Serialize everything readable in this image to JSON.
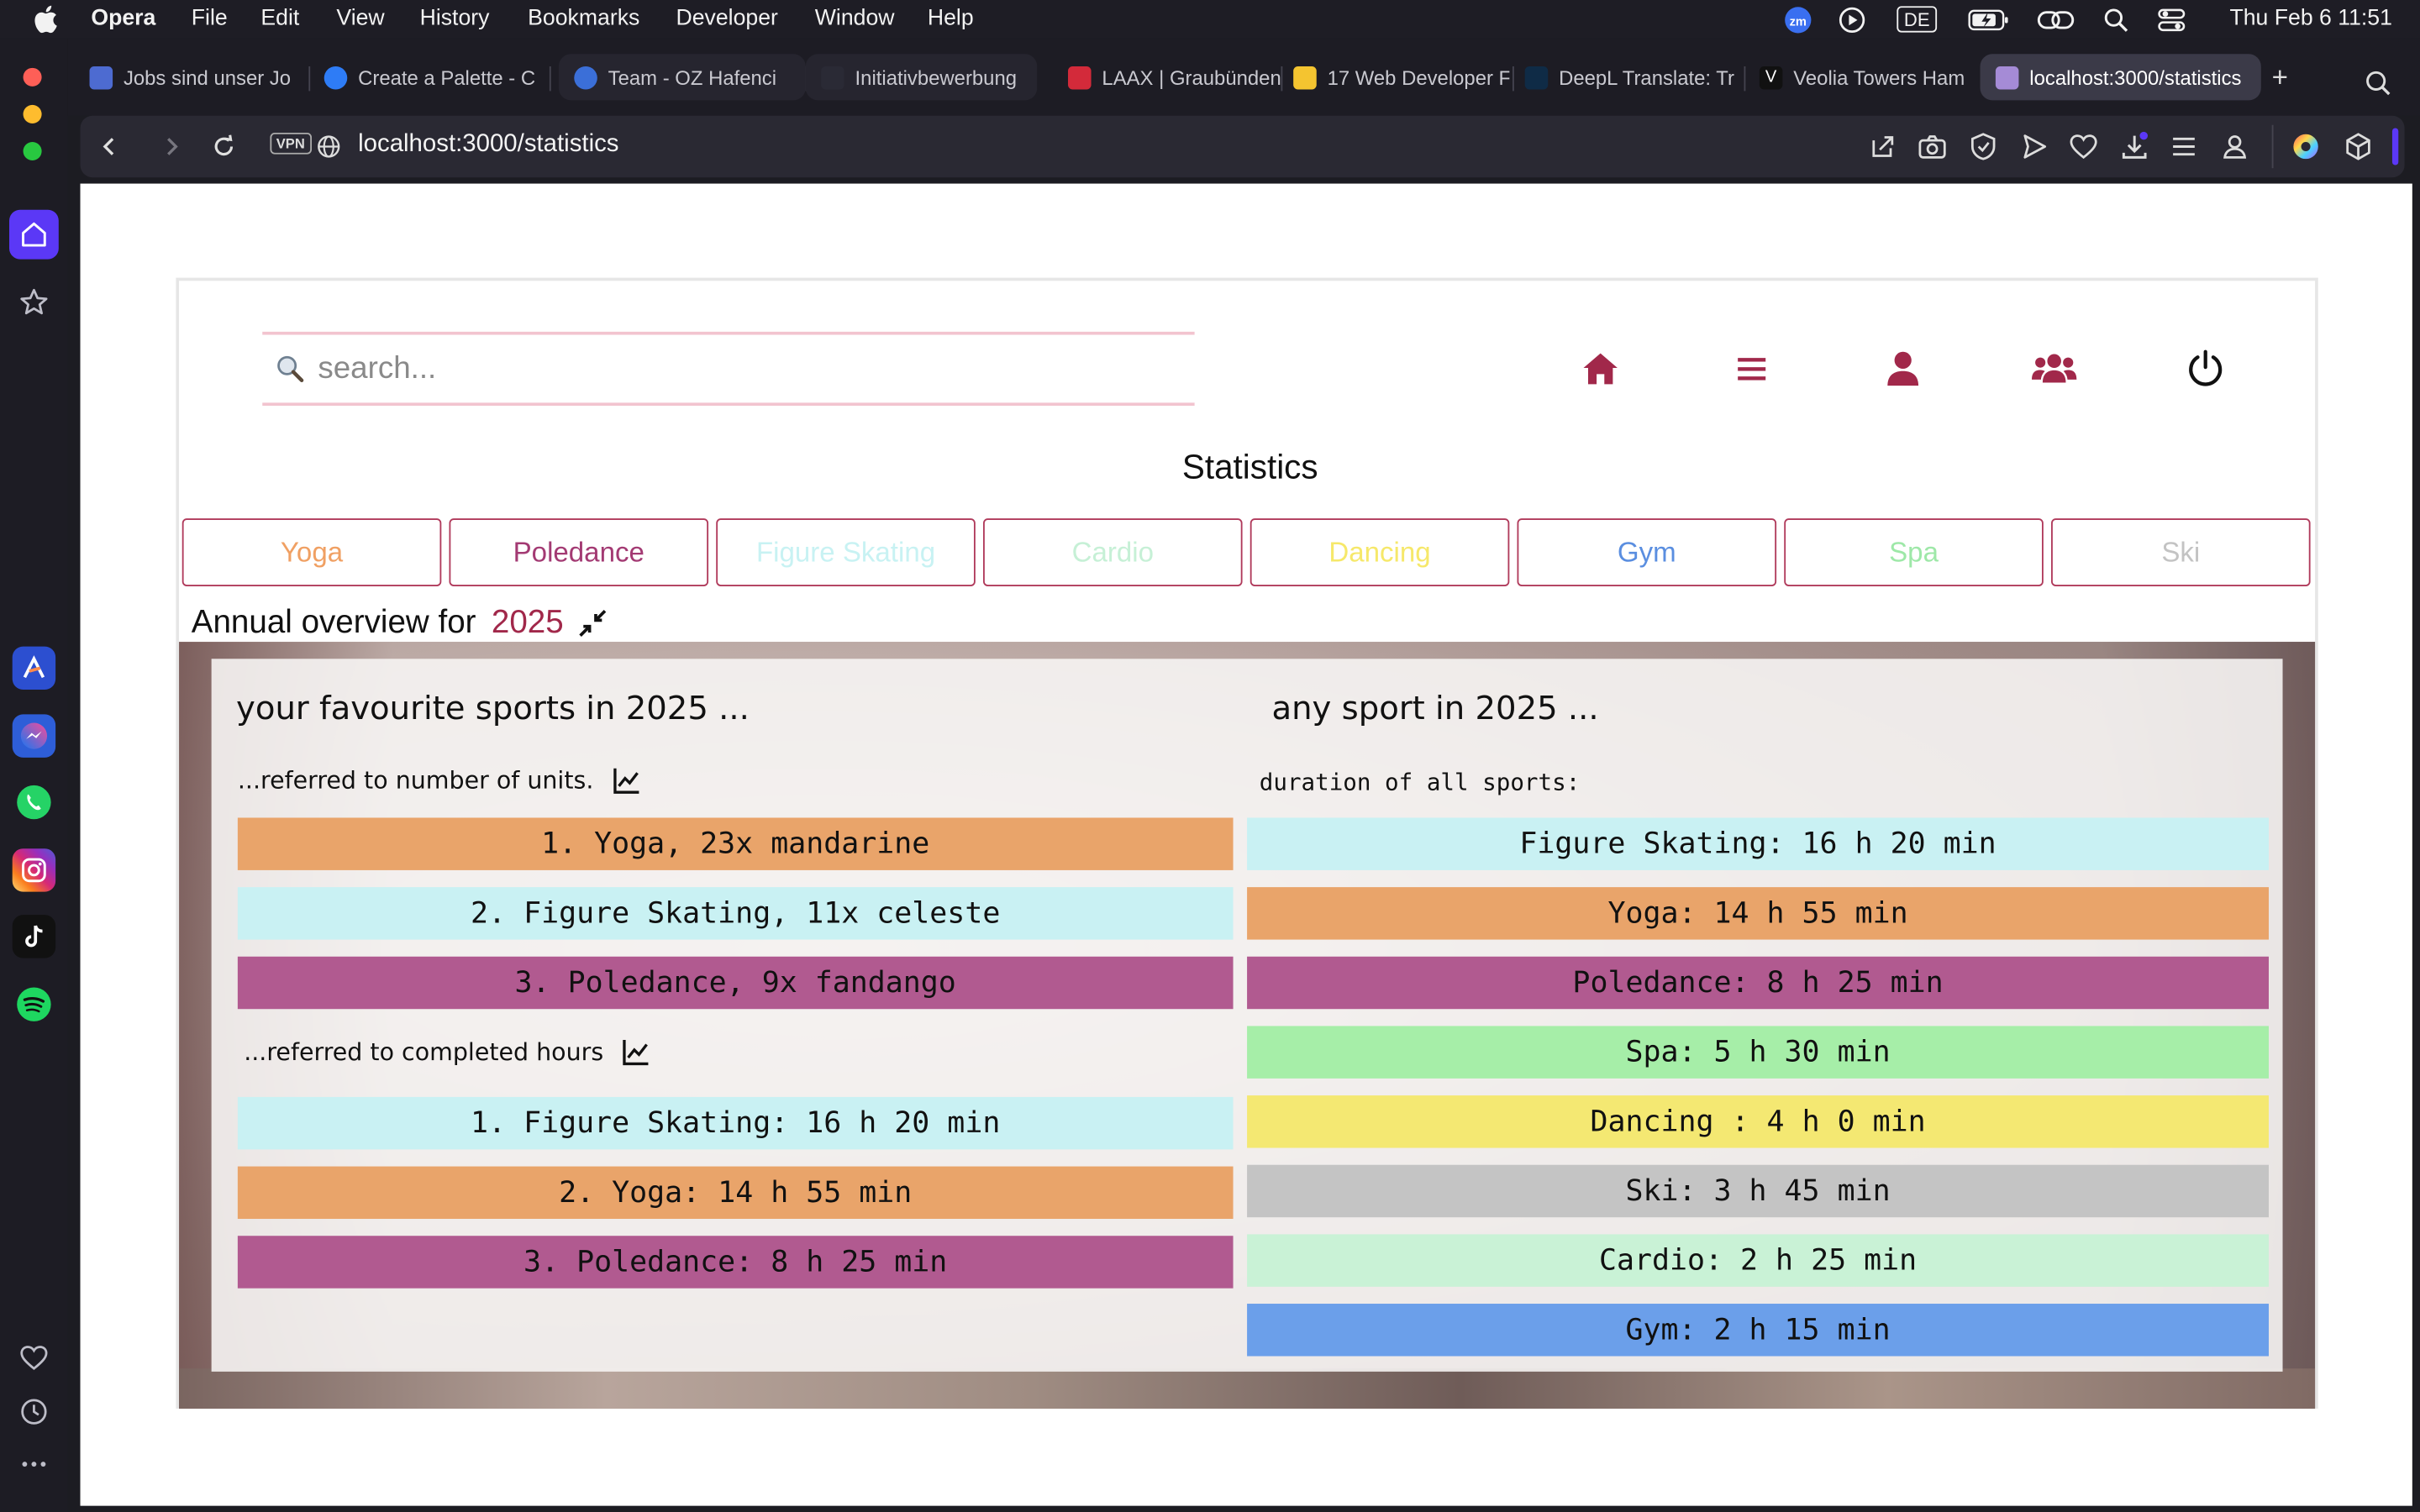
{
  "menubar": {
    "app": "Opera",
    "items": [
      "File",
      "Edit",
      "View",
      "History",
      "Bookmarks",
      "Developer",
      "Window",
      "Help"
    ],
    "keyboard": "DE",
    "clock": "Thu Feb 6  11:51"
  },
  "tabs": [
    {
      "label": "Jobs sind unser Jo",
      "fav": "#4d6bd1"
    },
    {
      "label": "Create a Palette - C",
      "fav": "#2e7cf6"
    },
    {
      "label": "Team - OZ Hafenci",
      "fav": "#3b6fd8"
    },
    {
      "label": "Initiativbewerbung",
      "fav": "#2a2a35"
    },
    {
      "label": "LAAX | Graubünden",
      "fav": "#d32a3a"
    },
    {
      "label": "17 Web Developer F",
      "fav": "#f4c430"
    },
    {
      "label": "DeepL Translate: Tr",
      "fav": "#0f2b46"
    },
    {
      "label": "Veolia Towers Ham",
      "fav": "#111111"
    },
    {
      "label": "localhost:3000/statistics",
      "fav": "#a58bd6"
    }
  ],
  "address": {
    "vpn": "VPN",
    "url": "localhost:3000/statistics"
  },
  "search": {
    "placeholder": "search..."
  },
  "page": {
    "title": "Statistics",
    "sports": [
      {
        "label": "Yoga",
        "color": "#f0a063"
      },
      {
        "label": "Poledance",
        "color": "#a33a73"
      },
      {
        "label": "Figure Skating",
        "color": "#c8f2f3"
      },
      {
        "label": "Cardio",
        "color": "#c6f0d6"
      },
      {
        "label": "Dancing",
        "color": "#f6e86a"
      },
      {
        "label": "Gym",
        "color": "#5a8ee0"
      },
      {
        "label": "Spa",
        "color": "#9ee8a8"
      },
      {
        "label": "Ski",
        "color": "#c3c3c3"
      }
    ],
    "annual_label": "Annual overview for",
    "year": "2025",
    "left": {
      "title": "your favourite sports in 2025 ...",
      "units_label": "...referred to number of units.",
      "units": [
        {
          "text": "1. Yoga, 23x mandarine",
          "color": "#e9a46a"
        },
        {
          "text": "2. Figure Skating, 11x celeste",
          "color": "#c9f1f3"
        },
        {
          "text": "3. Poledance, 9x fandango",
          "color": "#b15a90"
        }
      ],
      "hours_label": "...referred to completed hours",
      "hours": [
        {
          "text": "1. Figure Skating: 16 h 20 min",
          "color": "#c9f1f3"
        },
        {
          "text": "2. Yoga: 14 h 55 min",
          "color": "#e9a46a"
        },
        {
          "text": "3. Poledance: 8 h 25 min",
          "color": "#b15a90"
        }
      ]
    },
    "right": {
      "title": "any sport in 2025 ...",
      "duration_label": "duration of all sports:",
      "durations": [
        {
          "text": "Figure Skating: 16 h 20 min",
          "color": "#c9f1f3"
        },
        {
          "text": "Yoga: 14 h 55 min",
          "color": "#e9a46a"
        },
        {
          "text": "Poledance: 8 h 25 min",
          "color": "#b15a90"
        },
        {
          "text": "Spa: 5 h 30 min",
          "color": "#a6eea8"
        },
        {
          "text": "Dancing : 4 h 0 min",
          "color": "#f4e872"
        },
        {
          "text": "Ski: 3 h 45 min",
          "color": "#c4c4c4"
        },
        {
          "text": "Cardio: 2 h 25 min",
          "color": "#c9f2d6"
        },
        {
          "text": "Gym: 2 h 15 min",
          "color": "#6b9fea"
        }
      ]
    }
  }
}
